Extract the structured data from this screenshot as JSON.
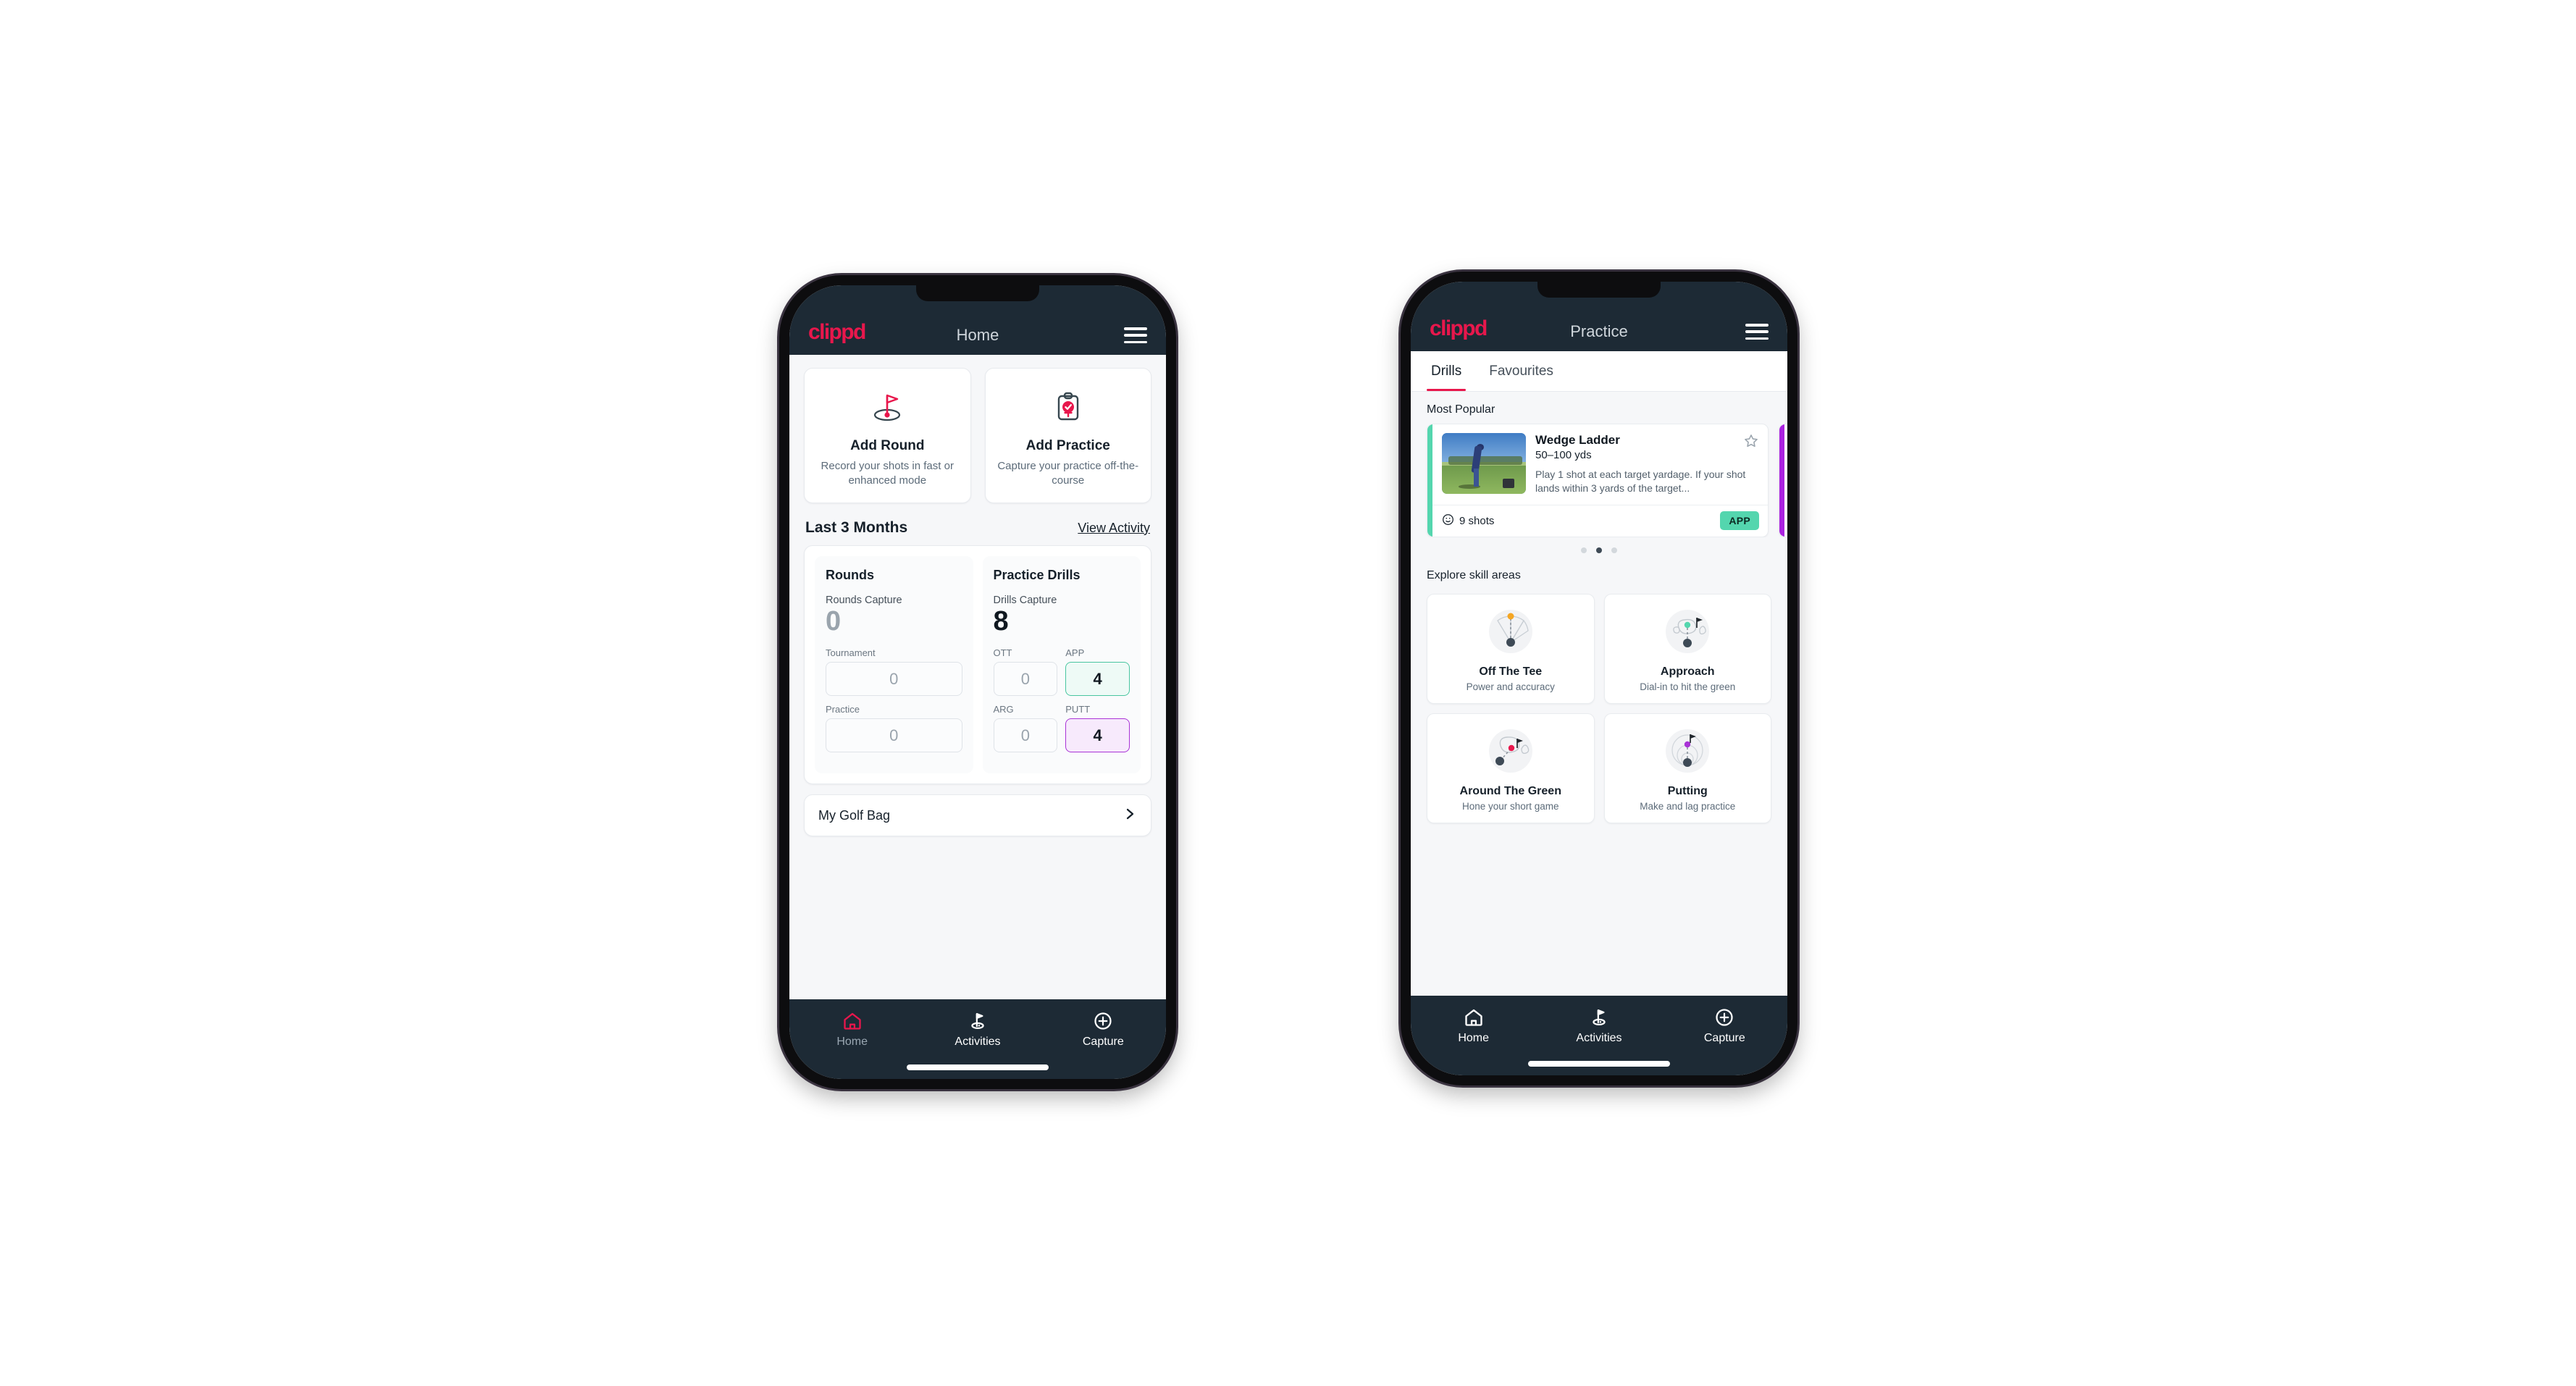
{
  "colors": {
    "brand_pink": "#e8174c",
    "appbar_dark": "#1d2a35",
    "accent_green": "#54d6ae",
    "accent_purple": "#ab22e0",
    "page_bg": "#f6f7f9"
  },
  "home": {
    "appbar": {
      "logo": "clippd",
      "title": "Home",
      "menu_icon": "hamburger-icon"
    },
    "quick_actions": [
      {
        "icon": "golf-flag-hole-icon",
        "title": "Add Round",
        "subtitle": "Record your shots in fast or enhanced mode"
      },
      {
        "icon": "clipboard-check-icon",
        "title": "Add Practice",
        "subtitle": "Capture your practice off-the-course"
      }
    ],
    "section": {
      "title": "Last 3 Months",
      "link": "View Activity"
    },
    "stats": {
      "rounds": {
        "title": "Rounds",
        "capture_label": "Rounds Capture",
        "capture_value": "0",
        "fields": [
          {
            "label": "Tournament",
            "value": "0",
            "state": "default"
          },
          {
            "label": "Practice",
            "value": "0",
            "state": "default"
          }
        ]
      },
      "drills": {
        "title": "Practice Drills",
        "capture_label": "Drills Capture",
        "capture_value": "8",
        "fields": [
          {
            "label": "OTT",
            "value": "0",
            "state": "default"
          },
          {
            "label": "APP",
            "value": "4",
            "state": "green"
          },
          {
            "label": "ARG",
            "value": "0",
            "state": "default"
          },
          {
            "label": "PUTT",
            "value": "4",
            "state": "purple"
          }
        ]
      }
    },
    "golf_bag": {
      "label": "My Golf Bag",
      "chevron_icon": "chevron-right-icon"
    },
    "bottom_nav": [
      {
        "icon": "home-icon",
        "label": "Home",
        "state": "active-pink"
      },
      {
        "icon": "golf-flag-icon",
        "label": "Activities",
        "state": "default"
      },
      {
        "icon": "plus-circle-icon",
        "label": "Capture",
        "state": "default"
      }
    ]
  },
  "practice": {
    "appbar": {
      "logo": "clippd",
      "title": "Practice",
      "menu_icon": "hamburger-icon"
    },
    "tabs": [
      {
        "label": "Drills",
        "active": true
      },
      {
        "label": "Favourites",
        "active": false
      }
    ],
    "most_popular_label": "Most Popular",
    "drill_card": {
      "title": "Wedge Ladder",
      "yardage": "50–100 yds",
      "description": "Play 1 shot at each target yardage. If your shot lands within 3 yards of the target...",
      "shots": "9 shots",
      "shots_icon": "target-icon",
      "chip": "APP",
      "star_icon": "star-outline-icon",
      "thumbnail_alt": "golfer-hitting-wedge-photo",
      "accent": "green"
    },
    "next_card_accent": "purple",
    "pager": {
      "count": 3,
      "active_index": 1
    },
    "skill_section_label": "Explore skill areas",
    "skill_areas": [
      {
        "icon": "tee-shot-dispersion-icon",
        "title": "Off The Tee",
        "subtitle": "Power and accuracy",
        "dot_color": "#f5a623"
      },
      {
        "icon": "approach-green-icon",
        "title": "Approach",
        "subtitle": "Dial-in to hit the green",
        "dot_color": "#54d6ae"
      },
      {
        "icon": "chip-green-icon",
        "title": "Around The Green",
        "subtitle": "Hone your short game",
        "dot_color": "#e8174c"
      },
      {
        "icon": "putting-rings-icon",
        "title": "Putting",
        "subtitle": "Make and lag practice",
        "dot_color": "#a933d6"
      }
    ],
    "bottom_nav": [
      {
        "icon": "home-icon",
        "label": "Home",
        "state": "active-white"
      },
      {
        "icon": "golf-flag-icon",
        "label": "Activities",
        "state": "default"
      },
      {
        "icon": "plus-circle-icon",
        "label": "Capture",
        "state": "default"
      }
    ]
  }
}
